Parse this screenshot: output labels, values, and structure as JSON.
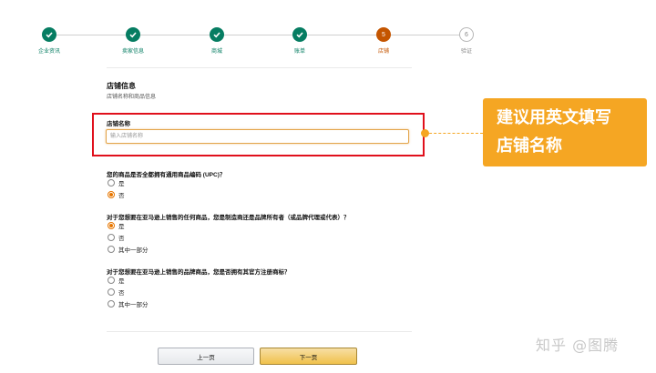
{
  "steps": [
    {
      "label": "企业资讯",
      "state": "done",
      "number": ""
    },
    {
      "label": "卖家信息",
      "state": "done",
      "number": ""
    },
    {
      "label": "商城",
      "state": "done",
      "number": ""
    },
    {
      "label": "账单",
      "state": "done",
      "number": ""
    },
    {
      "label": "店铺",
      "state": "active",
      "number": "5"
    },
    {
      "label": "验证",
      "state": "todo",
      "number": "6"
    }
  ],
  "section": {
    "title": "店铺信息",
    "subtitle": "店铺名称和商品信息"
  },
  "store_name": {
    "label": "店铺名称",
    "placeholder": "输入店铺名称",
    "value": ""
  },
  "callout": {
    "line1": "建议用英文填写",
    "line2": "店铺名称"
  },
  "questions": [
    {
      "text": "您的商品是否全都拥有通用商品编码 (UPC)？",
      "options": [
        {
          "label": "是",
          "checked": false
        },
        {
          "label": "否",
          "checked": true
        }
      ]
    },
    {
      "text": "对于您想要在亚马逊上销售的任何商品，您是制造商还是品牌所有者（或品牌代理或代表）？",
      "options": [
        {
          "label": "是",
          "checked": true
        },
        {
          "label": "否",
          "checked": false
        },
        {
          "label": "其中一部分",
          "checked": false
        }
      ]
    },
    {
      "text": "对于您想要在亚马逊上销售的品牌商品，您是否拥有其官方注册商标？",
      "options": [
        {
          "label": "是",
          "checked": false
        },
        {
          "label": "否",
          "checked": false
        },
        {
          "label": "其中一部分",
          "checked": false
        }
      ]
    }
  ],
  "buttons": {
    "prev": "上一页",
    "next": "下一页"
  },
  "watermark": "知乎 @图腾",
  "colors": {
    "done": "#067d62",
    "active": "#c45500",
    "highlight_border": "#e0101c",
    "callout": "#f5a623",
    "radio_checked": "#e77600"
  }
}
